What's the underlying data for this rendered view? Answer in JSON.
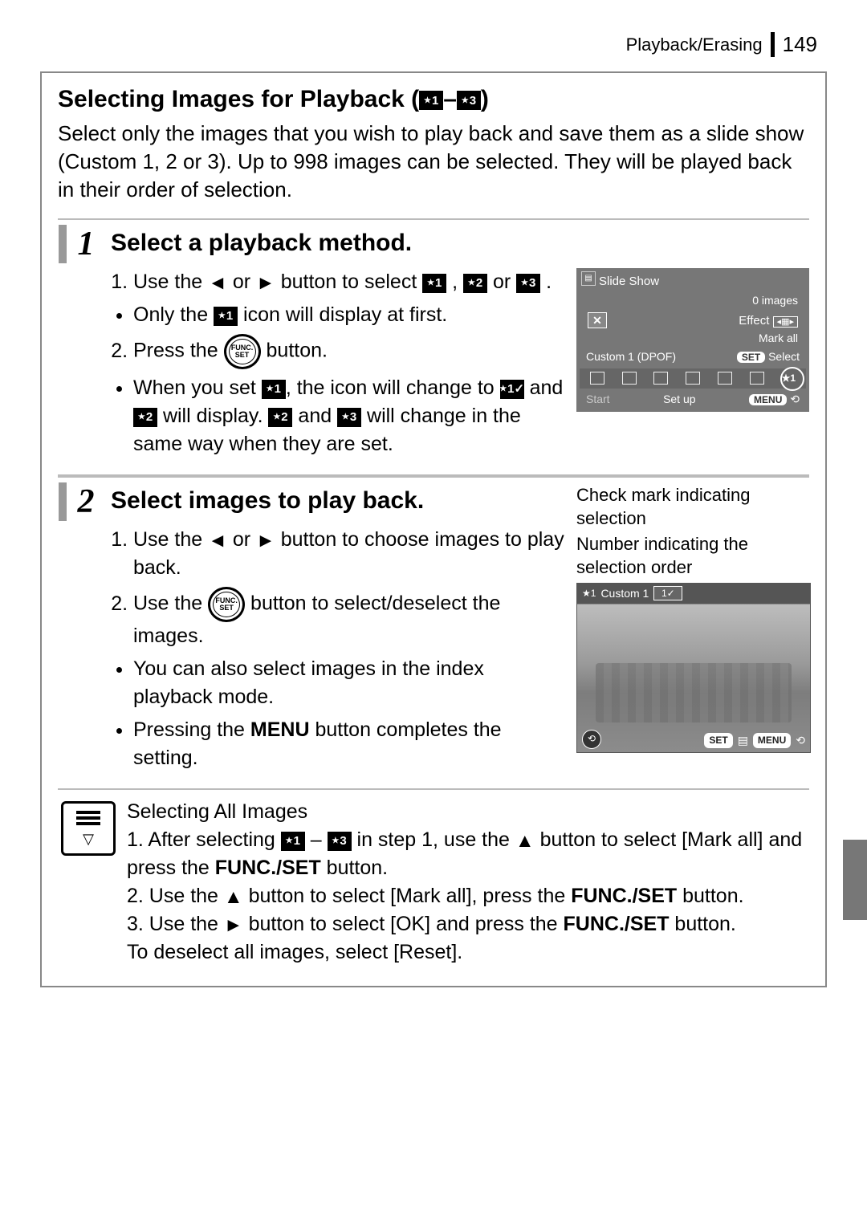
{
  "header": {
    "section": "Playback/Erasing",
    "page": "149"
  },
  "section": {
    "title_prefix": "Selecting Images for Playback (",
    "title_badge_from": "★1",
    "title_dash": "–",
    "title_badge_to": "★3",
    "title_suffix": ")",
    "intro": "Select only the images that you wish to play back and save them as a slide show (Custom 1, 2 or 3). Up to 998 images can be selected. They will be played back in their order of selection."
  },
  "step1": {
    "num": "1",
    "heading": "Select a playback method.",
    "li1_a": "Use the ",
    "li1_b": " or ",
    "li1_c": " button to select ",
    "li1_d": " , ",
    "li1_e": " or ",
    "li1_f": " .",
    "note1_a": "Only the ",
    "note1_b": " icon will display at first.",
    "li2_a": "Press the ",
    "li2_b": " button.",
    "note2_a": "When you set ",
    "note2_b": ", the icon will change to ",
    "note2_c": " and ",
    "note2_d": " will display. ",
    "note2_e": " and ",
    "note2_f": " will change in the same way when they are set.",
    "screen": {
      "title": "Slide Show",
      "images": "0 images",
      "effect": "Effect",
      "mark_all": "Mark all",
      "custom": "Custom 1 (DPOF)",
      "set_select": "SET Select",
      "start": "Start",
      "setup": "Set up",
      "menu": "MENU"
    }
  },
  "step2": {
    "num": "2",
    "heading": "Select images to play back.",
    "li1_a": "Use the ",
    "li1_b": " or ",
    "li1_c": " button to choose images to play back.",
    "li2_a": "Use the ",
    "li2_b": " button to select/deselect the images.",
    "note1": "You can also select images in the index playback mode.",
    "note2_a": "Pressing the ",
    "note2_b": "MENU",
    "note2_c": " button completes the setting.",
    "caption1": "Check mark indicating selection",
    "caption2_a": "Number indicating the",
    "caption2_b": "selection order",
    "screen": {
      "custom": "Custom 1",
      "check": "1✓",
      "set": "SET",
      "menu": "MENU",
      "star": "★1"
    }
  },
  "notes": {
    "heading": "Selecting All Images",
    "n1_a": "1. After selecting ",
    "n1_b": " – ",
    "n1_c": " in step 1, use the ",
    "n1_d": " button to select [Mark all] and press the ",
    "n1_e": "FUNC./SET",
    "n1_f": " button.",
    "n2_a": "2. Use the ",
    "n2_b": " button to select [Mark all], press the ",
    "n2_c": "FUNC./SET",
    "n2_d": " button.",
    "n3_a": "3. Use the ",
    "n3_b": " button to select [OK] and press the ",
    "n3_c": "FUNC./SET",
    "n3_d": " button.",
    "n4": "To deselect all images, select [Reset]."
  }
}
